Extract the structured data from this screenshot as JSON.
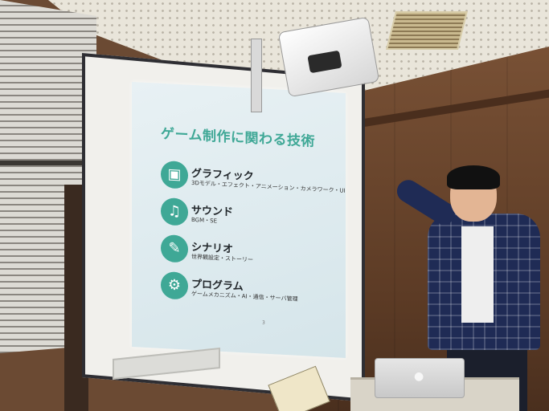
{
  "slide": {
    "title": "ゲーム制作に関わる技術",
    "items": [
      {
        "label": "グラフィック",
        "sub": "3Dモデル・エフェクト・アニメーション・カメラワーク・UI",
        "icon": "video-camera-icon"
      },
      {
        "label": "サウンド",
        "sub": "BGM・SE",
        "icon": "music-note-icon"
      },
      {
        "label": "シナリオ",
        "sub": "世界観設定・ストーリー",
        "icon": "document-pen-icon"
      },
      {
        "label": "プログラム",
        "sub": "ゲームメカニズム・AI・通信・サーバ管理",
        "icon": "gears-icon"
      }
    ],
    "page_number": "3",
    "accent_color": "#3fa896"
  }
}
